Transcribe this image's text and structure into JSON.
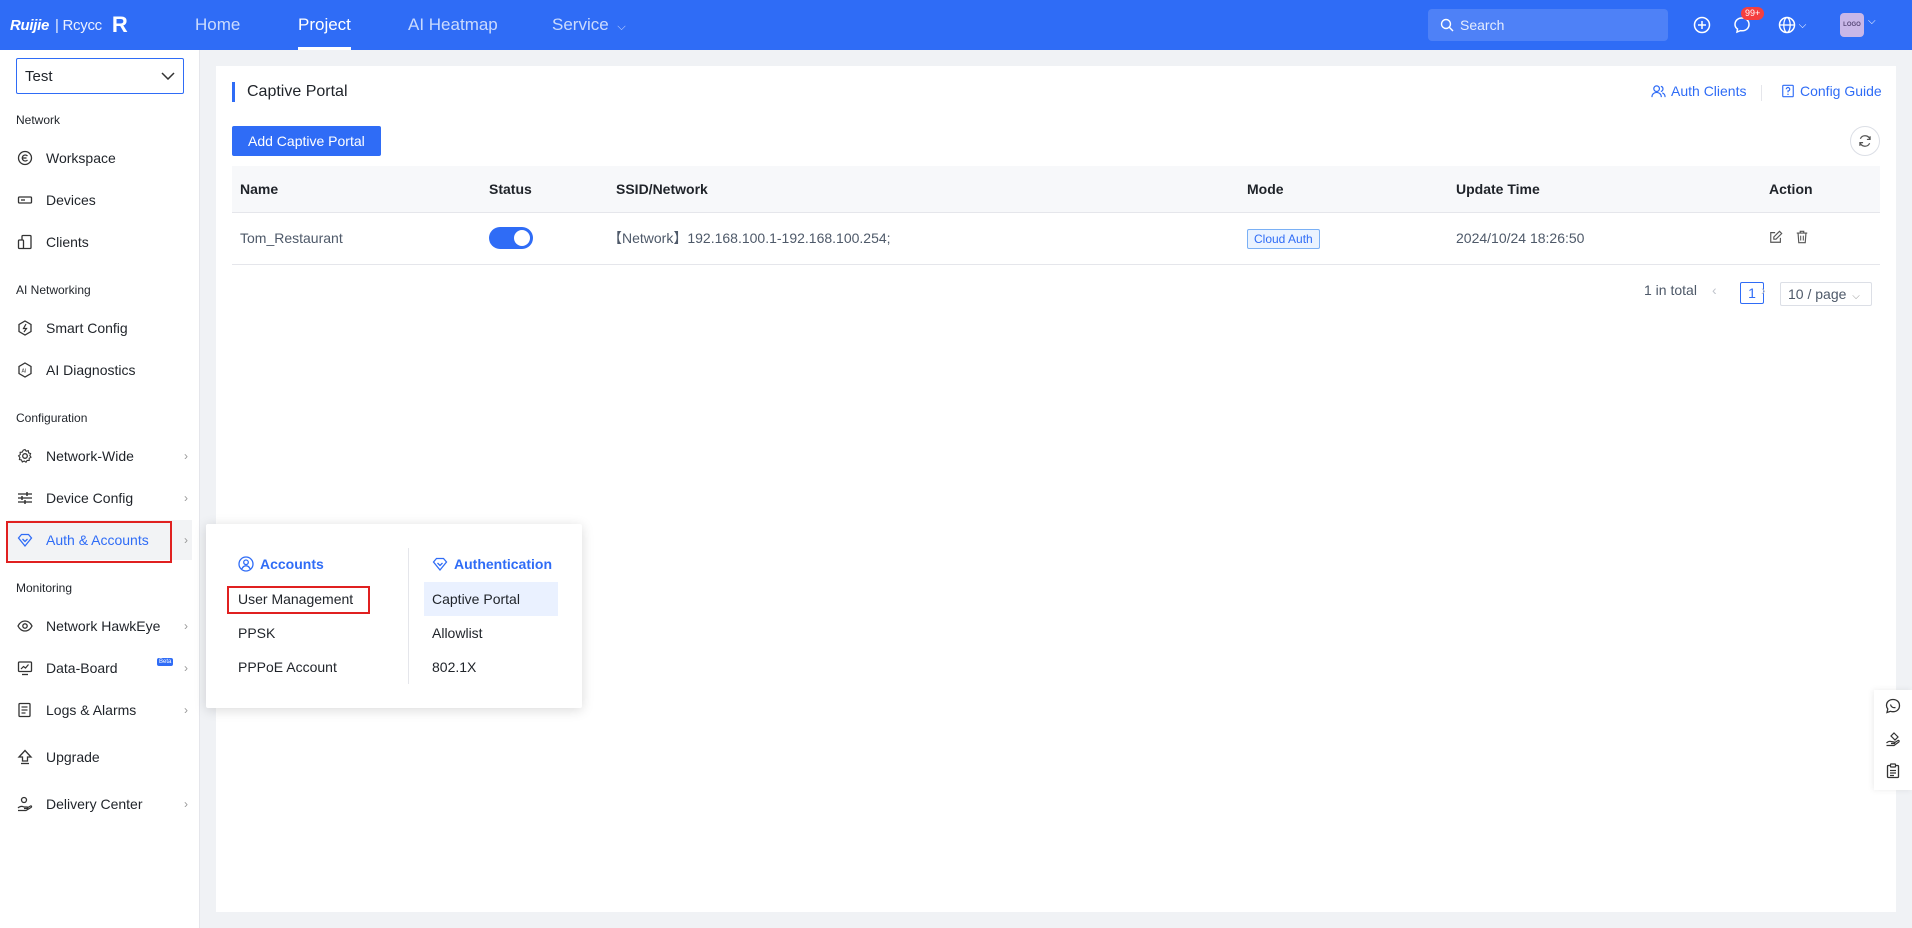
{
  "brand": {
    "name": "Ruijie",
    "sep": "| Rcycc"
  },
  "nav": [
    {
      "label": "Home"
    },
    {
      "label": "Project"
    },
    {
      "label": "AI Heatmap"
    },
    {
      "label": "Service"
    }
  ],
  "search": {
    "placeholder": "Search"
  },
  "header": {
    "notifications_badge": "99+",
    "avatar_text": "LOGO"
  },
  "sidebar": {
    "site": "Test",
    "groups": {
      "network": "Network",
      "ai_networking": "AI Networking",
      "configuration": "Configuration",
      "monitoring": "Monitoring"
    },
    "items": {
      "workspace": "Workspace",
      "devices": "Devices",
      "clients": "Clients",
      "smart_config": "Smart Config",
      "ai_diagnostics": "AI Diagnostics",
      "network_wide": "Network-Wide",
      "device_config": "Device Config",
      "auth_accounts": "Auth & Accounts",
      "network_hawkeye": "Network HawkEye",
      "data_board": "Data-Board",
      "logs_alarms": "Logs & Alarms",
      "upgrade": "Upgrade",
      "delivery_center": "Delivery Center"
    },
    "beta_badge": "Beta"
  },
  "page": {
    "title": "Captive Portal",
    "auth_clients": "Auth Clients",
    "config_guide": "Config Guide",
    "add_button": "Add Captive Portal"
  },
  "table": {
    "headers": {
      "name": "Name",
      "status": "Status",
      "ssid": "SSID/Network",
      "mode": "Mode",
      "update_time": "Update Time",
      "action": "Action"
    },
    "rows": [
      {
        "name": "Tom_Restaurant",
        "status": "on",
        "ssid": "【Network】192.168.100.1-192.168.100.254;",
        "mode": "Cloud Auth",
        "update_time": "2024/10/24 18:26:50"
      }
    ]
  },
  "pagination": {
    "total": "1 in total",
    "current": "1",
    "page_size": "10 / page"
  },
  "flyout": {
    "accounts": {
      "heading": "Accounts",
      "items": [
        "User Management",
        "PPSK",
        "PPPoE Account"
      ]
    },
    "authentication": {
      "heading": "Authentication",
      "items": [
        "Captive Portal",
        "Allowlist",
        "802.1X"
      ]
    }
  },
  "colors": {
    "primary": "#2f6cf6",
    "highlight_box": "#e02020"
  }
}
